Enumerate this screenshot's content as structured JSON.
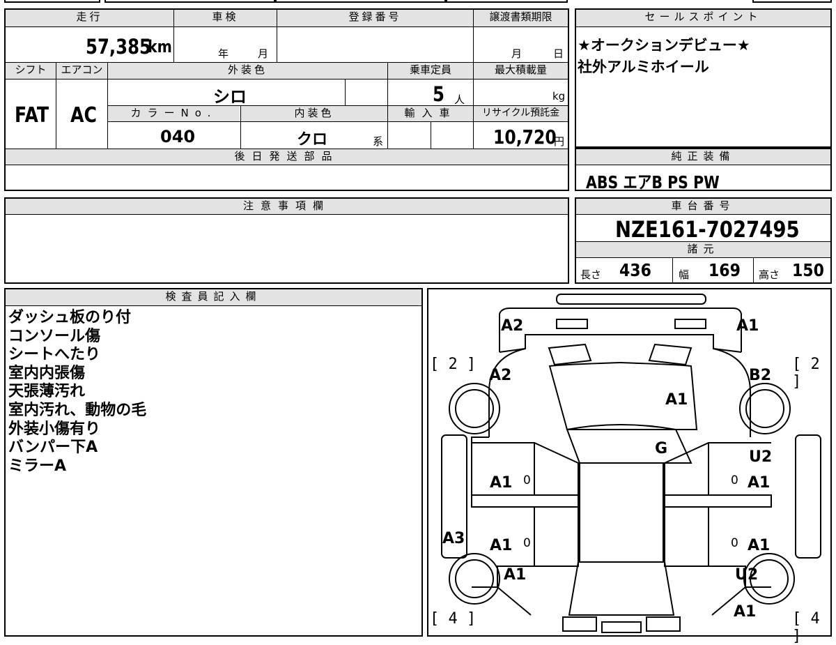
{
  "top": {
    "mileage_label": "走行",
    "mileage_value": "57,385",
    "mileage_unit": "km",
    "inspection_label": "車検",
    "inspection_year": "年",
    "inspection_month": "月",
    "registration_label": "登録番号",
    "transfer_label": "譲渡書類期限",
    "transfer_month": "月",
    "transfer_day": "日",
    "shift_label": "シフト",
    "shift_value": "FAT",
    "ac_label": "エアコン",
    "ac_value": "AC",
    "exterior_label": "外装色",
    "exterior_value": "シロ",
    "capacity_label": "乗車定員",
    "capacity_value": "5",
    "capacity_unit": "人",
    "maxload_label": "最大積載量",
    "maxload_unit": "kg",
    "colorno_label": "カラーNo.",
    "colorno_value": "040",
    "interior_label": "内装色",
    "interior_value": "クロ",
    "interior_suffix": "系",
    "import_label": "輸入車",
    "recycle_label": "リサイクル預託金",
    "recycle_value": "10,720",
    "recycle_unit": "円",
    "later_parts_label": "後日発送部品"
  },
  "sales": {
    "title": "セールスポイント",
    "line1": "★オークションデビュー★",
    "line2": "社外アルミホイール"
  },
  "equipment": {
    "title": "純正装備",
    "value": "ABS エアB PS PW"
  },
  "notes": {
    "title": "注意事項欄"
  },
  "chassis": {
    "title": "車台番号",
    "value": "NZE161-7027495",
    "spec_title": "諸元",
    "length_label": "長さ",
    "length_value": "436",
    "width_label": "幅",
    "width_value": "169",
    "height_label": "高さ",
    "height_value": "150"
  },
  "inspector": {
    "title": "検査員記入欄",
    "lines": [
      "ダッシュ板のり付",
      "コンソール傷",
      "シートへたり",
      "室内内張傷",
      "天張薄汚れ",
      "室内汚れ、動物の毛",
      "外装小傷有り",
      "バンパー下A",
      "ミラーA"
    ]
  },
  "diagram": {
    "labels": [
      "A2",
      "A1",
      "A2",
      "B2",
      "A1",
      "G",
      "U2",
      "A1",
      "A1",
      "A3",
      "A1",
      "A1",
      "A1",
      "U2",
      "A1"
    ],
    "brackets": [
      "[ 2 ]",
      "[ 2 ]",
      "[ 4 ]",
      "[ 4 ]"
    ],
    "zeros": [
      "0",
      "0",
      "0",
      "0"
    ]
  }
}
